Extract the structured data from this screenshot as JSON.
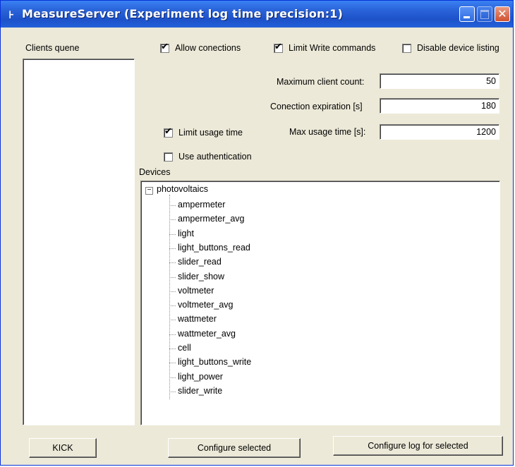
{
  "window": {
    "title": "MeasureServer (Experiment log time precision:1)",
    "close_glyph": "✕"
  },
  "clients": {
    "label": "Clients quene",
    "items": []
  },
  "options": {
    "allow_connections": {
      "label": "Allow conections",
      "checked": true
    },
    "limit_write": {
      "label": "Limit Write commands",
      "checked": true
    },
    "disable_listing": {
      "label": "Disable device listing",
      "checked": false
    },
    "limit_usage": {
      "label": "Limit usage time",
      "checked": true
    },
    "use_auth": {
      "label": "Use authentication",
      "checked": false
    },
    "check_glyph": "✔"
  },
  "fields": {
    "max_clients": {
      "label": "Maximum client count:",
      "value": "50"
    },
    "expiration": {
      "label": "Conection expiration [s]",
      "value": "180"
    },
    "max_usage": {
      "label": "Max usage time [s]:",
      "value": "1200"
    }
  },
  "devices": {
    "label": "Devices",
    "root": "photovoltaics",
    "root_expander": "−",
    "children": [
      "ampermeter",
      "ampermeter_avg",
      "light",
      "light_buttons_read",
      "slider_read",
      "slider_show",
      "voltmeter",
      "voltmeter_avg",
      "wattmeter",
      "wattmeter_avg",
      "cell",
      "light_buttons_write",
      "light_power",
      "slider_write"
    ]
  },
  "buttons": {
    "kick": "KICK",
    "configure": "Configure selected",
    "configure_log": "Configure log for selected"
  }
}
